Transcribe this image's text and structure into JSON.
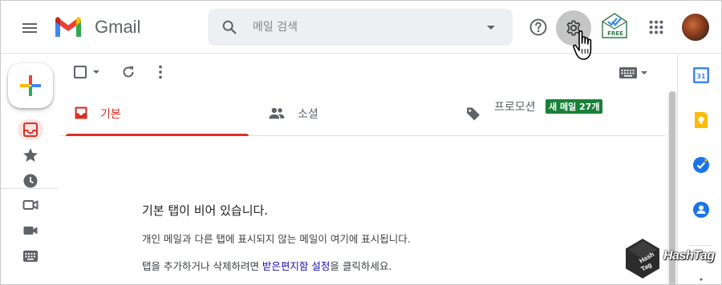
{
  "header": {
    "app_name": "Gmail",
    "search": {
      "placeholder": "메일 검색"
    },
    "extension_badge": "FREE"
  },
  "tabs": [
    {
      "label": "기본",
      "icon": "inbox-icon",
      "active": true
    },
    {
      "label": "소셜",
      "icon": "people-icon",
      "active": false
    },
    {
      "label": "프로모션",
      "icon": "tag-icon",
      "active": false,
      "badge": "새 메일 27개"
    }
  ],
  "empty_state": {
    "title": "기본 탭이 비어 있습니다.",
    "description": "개인 메일과 다른 탭에 표시되지 않는 메일이 여기에 표시됩니다.",
    "hint_before": "탭을 추가하거나 삭제하려면 ",
    "hint_link": "받은편지함 설정",
    "hint_after": "을 클릭하세요."
  },
  "watermark": {
    "text": "HashTag"
  },
  "colors": {
    "accent_red": "#d93025",
    "promo_badge_green": "#188038",
    "link_blue": "#1a0dab",
    "settings_hover": "#c6c6c6"
  }
}
